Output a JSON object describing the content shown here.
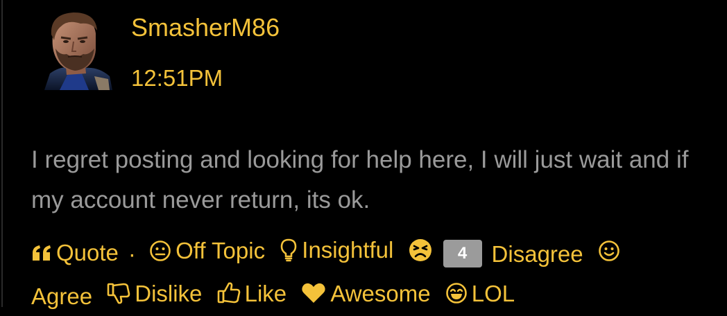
{
  "author": {
    "name": "SmasherM86",
    "time": "12:51PM"
  },
  "post": {
    "text": "I regret posting and looking for help here, I will just wait and if my account never return, its ok."
  },
  "reactions": {
    "quote": "Quote",
    "separator": "·",
    "off_topic": "Off Topic",
    "insightful": "Insightful",
    "disagree_count": "4",
    "disagree": "Disagree",
    "agree": "Agree",
    "dislike": "Dislike",
    "like": "Like",
    "awesome": "Awesome",
    "lol": "LOL"
  },
  "colors": {
    "background": "#000000",
    "accent": "#f4c23a",
    "body_text": "#9a9a9a",
    "badge": "#9b9b9b"
  }
}
